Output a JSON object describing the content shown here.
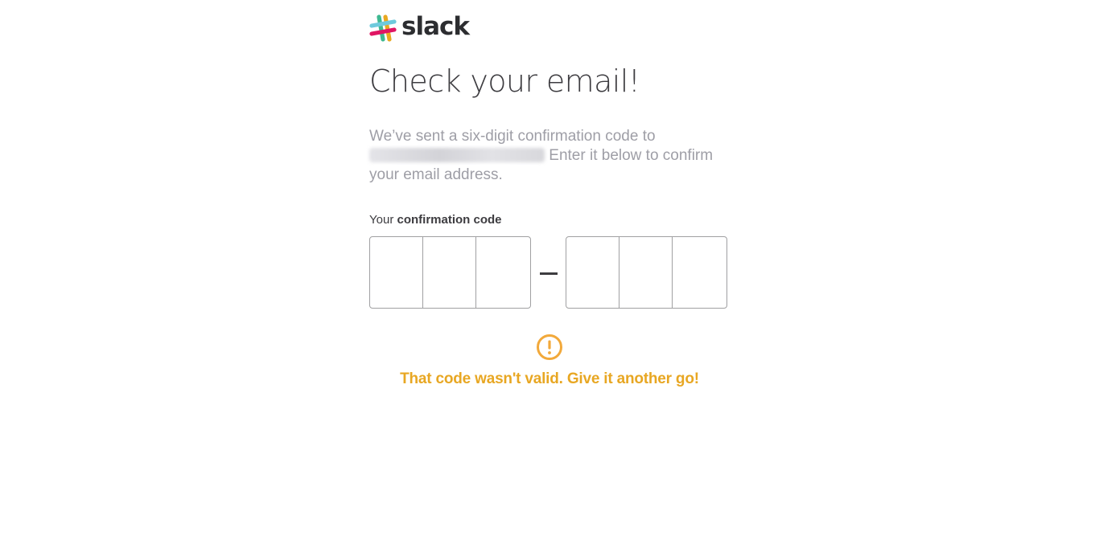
{
  "brand": {
    "name": "slack",
    "colors": {
      "teal": "#3eb991",
      "blue": "#6ecadc",
      "yellow": "#e9a820",
      "pink": "#e01563"
    }
  },
  "page": {
    "title": "Check your email!",
    "description_before": "We’ve sent a six-digit confirmation code to",
    "description_after": " Enter it below to confirm your email address."
  },
  "form": {
    "label_prefix": "Your ",
    "label_bold": "confirmation code",
    "separator": "–",
    "digits": [
      "",
      "",
      "",
      "",
      "",
      ""
    ]
  },
  "error": {
    "icon": "exclamation-circle-icon",
    "message": "That code wasn't valid. Give it another go!",
    "color": "#e8a723"
  }
}
